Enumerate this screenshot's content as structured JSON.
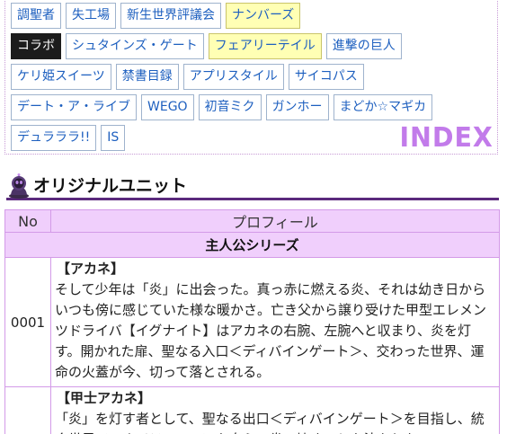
{
  "nav": {
    "rows": [
      [
        {
          "label": "調聖者",
          "style": "normal"
        },
        {
          "label": "失工場",
          "style": "normal"
        },
        {
          "label": "新生世界評議会",
          "style": "normal"
        },
        {
          "label": "ナンバーズ",
          "style": "highlight"
        }
      ],
      [
        {
          "label": "コラボ",
          "style": "active"
        },
        {
          "label": "シュタインズ・ゲート",
          "style": "normal"
        },
        {
          "label": "フェアリーテイル",
          "style": "highlight"
        },
        {
          "label": "進撃の巨人",
          "style": "normal"
        }
      ],
      [
        {
          "label": "ケリ姫スイーツ",
          "style": "normal"
        },
        {
          "label": "禁書目録",
          "style": "normal"
        },
        {
          "label": "アプリスタイル",
          "style": "normal"
        },
        {
          "label": "サイコパス",
          "style": "normal"
        }
      ],
      [
        {
          "label": "デート・ア・ライブ",
          "style": "normal"
        },
        {
          "label": "WEGO",
          "style": "normal"
        },
        {
          "label": "初音ミク",
          "style": "normal"
        },
        {
          "label": "ガンホー",
          "style": "normal"
        },
        {
          "label": "まどか☆マギカ",
          "style": "normal"
        }
      ],
      [
        {
          "label": "デュラララ!!",
          "style": "normal"
        },
        {
          "label": "IS",
          "style": "normal"
        }
      ]
    ],
    "logo_text": "INDEX"
  },
  "section": {
    "title": "オリジナルユニット",
    "icon": "robot-character-icon"
  },
  "table": {
    "header_no": "No",
    "header_profile": "プロフィール",
    "group_label": "主人公シリーズ",
    "rows": [
      {
        "no": "0001",
        "name": "【アカネ】",
        "text": "そして少年は「炎」に出会った。真っ赤に燃える炎、それは幼き日からいつも傍に感じていた様な暖かさ。亡き父から譲り受けた甲型エレメンツドライバ【イグナイト】はアカネの右腕、左腕へと収まり、炎を灯す。開かれた扉、聖なる入口＜ディバインゲート＞、交わった世界、運命の火蓋が今、切って落とされる。"
      },
      {
        "no": "",
        "name": "【甲士アカネ】",
        "text": "「炎」を灯す者として、聖なる出口＜ディバインゲート＞を目指し、統合世界＜ユナイティリア＞を自らの拳で壊すことを決心した"
      }
    ]
  },
  "colors": {
    "accent_purple": "#5b2a7d",
    "header_bg": "#f0cffc",
    "highlight_tag": "#ffffb4",
    "link_blue": "#1d5fbf",
    "logo_purple": "#c27bea"
  }
}
